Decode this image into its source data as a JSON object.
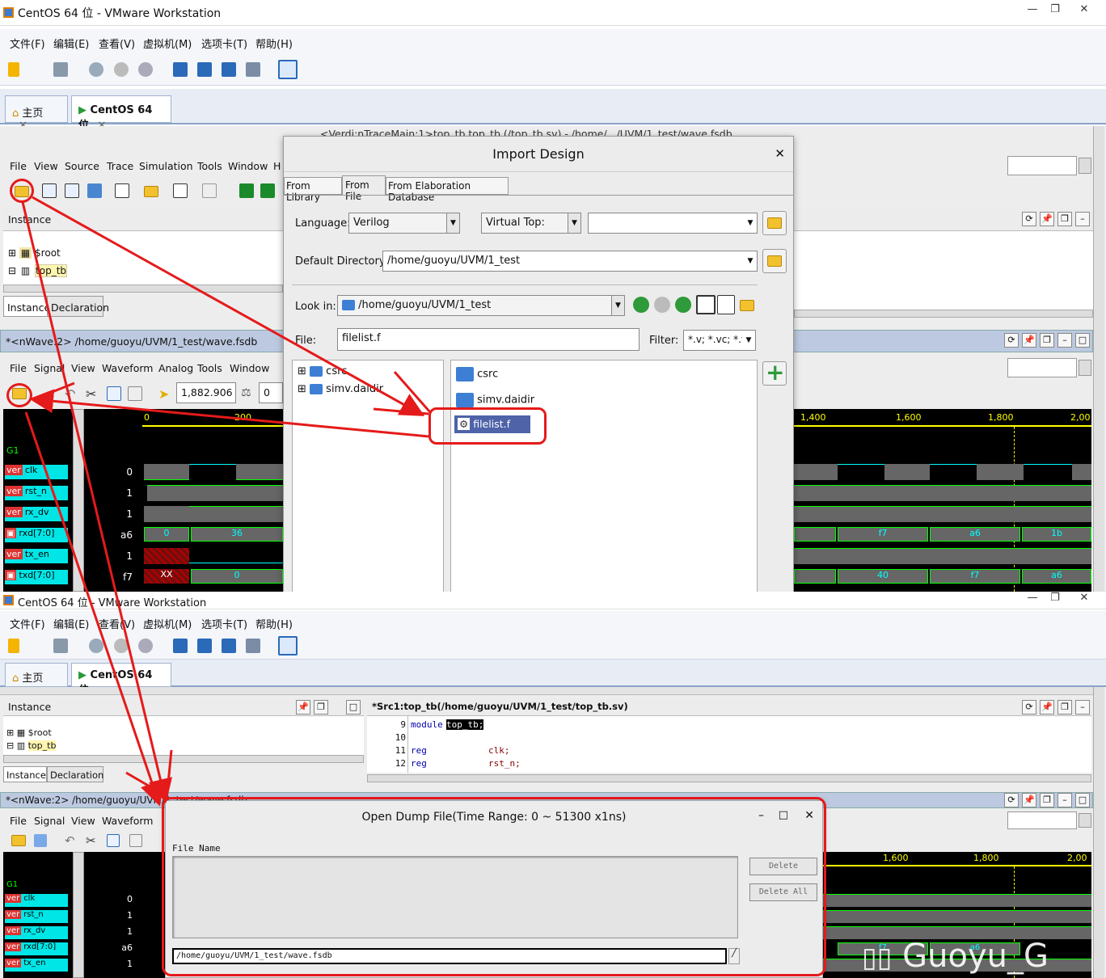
{
  "vm_top": {
    "title": "CentOS 64 位 - VMware Workstation",
    "menu": [
      "文件(F)",
      "编辑(E)",
      "查看(V)",
      "虚拟机(M)",
      "选项卡(T)",
      "帮助(H)"
    ],
    "tabs": [
      "主页",
      "CentOS 64 位"
    ]
  },
  "verdi_top": {
    "window_title": "<Verdi:nTraceMain:1>top_tb.top_tb (/top_tb.sv) - /home/.../UVM/1_test/wave.fsdb",
    "menu": [
      "File",
      "View",
      "Source",
      "Trace",
      "Simulation",
      "Tools",
      "Window",
      "H"
    ],
    "instance_label": "Instance",
    "tree": [
      "$root",
      "top_tb"
    ],
    "bottom_tabs": [
      "Instance",
      "Declaration"
    ]
  },
  "nwave_top": {
    "title": "*<nWave:2> /home/guoyu/UVM/1_test/wave.fsdb",
    "menu": [
      "File",
      "Signal",
      "View",
      "Waveform",
      "Analog",
      "Tools",
      "Window"
    ],
    "cursor_time": "1,882.906",
    "delta": "0",
    "group": "G1",
    "signals": [
      {
        "name": "clk",
        "value": "0"
      },
      {
        "name": "rst_n",
        "value": "1"
      },
      {
        "name": "rx_dv",
        "value": "1"
      },
      {
        "name": "rxd[7:0]",
        "value": "a6"
      },
      {
        "name": "tx_en",
        "value": "1"
      },
      {
        "name": "txd[7:0]",
        "value": "f7"
      }
    ],
    "ruler_left": [
      "0",
      "200"
    ],
    "ruler_right": [
      "1,400",
      "1,600",
      "1,800",
      "2,00"
    ],
    "rxd_left": [
      "0",
      "36"
    ],
    "rxd_right": [
      "f7",
      "a6",
      "1b"
    ],
    "txd_left": [
      "XX",
      "0"
    ],
    "txd_right": [
      "40",
      "f7",
      "a6"
    ]
  },
  "import_dialog": {
    "title": "Import Design",
    "tabs": [
      "From Library",
      "From File",
      "From Elaboration Database"
    ],
    "language_label": "Language:",
    "language_value": "Verilog",
    "virtual_top_label": "Virtual Top:",
    "default_dir_label": "Default Directory:",
    "default_dir_value": "/home/guoyu/UVM/1_test",
    "look_in_label": "Look in:",
    "look_in_value": "/home/guoyu/UVM/1_test",
    "file_label": "File:",
    "file_value": "filelist.f",
    "filter_label": "Filter:",
    "filter_value": "*.v; *.vc; *.f",
    "tree": [
      "csrc",
      "simv.daidir"
    ],
    "files": [
      "csrc",
      "simv.daidir",
      "filelist.f"
    ]
  },
  "vm_bottom": {
    "title": "CentOS 64 位 - VMware Workstation",
    "menu": [
      "文件(F)",
      "编辑(E)",
      "查看(V)",
      "虚拟机(M)",
      "选项卡(T)",
      "帮助(H)"
    ],
    "tabs": [
      "主页",
      "CentOS 64 位"
    ]
  },
  "verdi_bottom": {
    "instance_label": "Instance",
    "tree": [
      "$root",
      "top_tb"
    ],
    "bottom_tabs": [
      "Instance",
      "Declaration"
    ],
    "src_title": "*Src1:top_tb(/home/guoyu/UVM/1_test/top_tb.sv)",
    "code": [
      {
        "ln": "9",
        "kw": "module",
        "rest": "top_tb;"
      },
      {
        "ln": "10",
        "kw": "",
        "rest": ""
      },
      {
        "ln": "11",
        "kw": "reg",
        "rest": "clk;"
      },
      {
        "ln": "12",
        "kw": "reg",
        "rest": "rst_n;"
      }
    ],
    "nwave_title": "*<nWave:2> /home/guoyu/UVM/1_test/wave.fsdb",
    "nwave_menu": [
      "File",
      "Signal",
      "View",
      "Waveform",
      "Analog"
    ],
    "group": "G1",
    "signals": [
      {
        "name": "clk",
        "value": "0"
      },
      {
        "name": "rst_n",
        "value": "1"
      },
      {
        "name": "rx_dv",
        "value": "1"
      },
      {
        "name": "rxd[7:0]",
        "value": "a6"
      },
      {
        "name": "tx_en",
        "value": "1"
      }
    ],
    "ruler_right": [
      "1,600",
      "1,800",
      "2,00"
    ],
    "wave_values": [
      "f7",
      "a6"
    ]
  },
  "open_dump": {
    "title": "Open Dump File(Time Range: 0 ~ 51300 x1ns)",
    "file_name_label": "File Name",
    "delete_label": "Delete",
    "delete_all_label": "Delete All",
    "path_value": "/home/guoyu/UVM/1_test/wave.fsdb"
  },
  "watermark": "Guoyu_G",
  "colors": {
    "annotation": "#e51a1a",
    "signal_bg": "#00e6e6",
    "wave": "#00ff00"
  }
}
